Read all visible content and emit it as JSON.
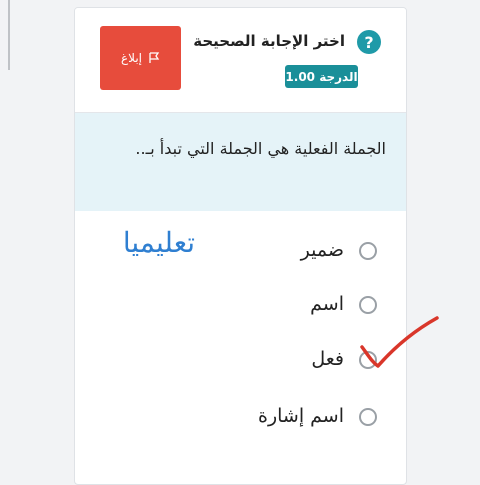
{
  "question_card": {
    "title": "اختر الإجابة الصحيحة",
    "grade_badge": "الدرجة 1.00",
    "report_label": "إبلاغ",
    "question_text": "الجملة الفعلية هي الجملة التي تبدأ بـ..",
    "options": [
      {
        "label": "ضمير"
      },
      {
        "label": "اسم"
      },
      {
        "label": "فعل"
      },
      {
        "label": "اسم إشارة"
      }
    ]
  },
  "overlay": {
    "watermark_text": "تعليميا",
    "watermark_color": "#2f7fd1",
    "checkmark_color": "#d9362a"
  },
  "colors": {
    "teal": "#1f9aa8",
    "report_red": "#e74c3c",
    "question_bg": "#e5f3f8"
  }
}
